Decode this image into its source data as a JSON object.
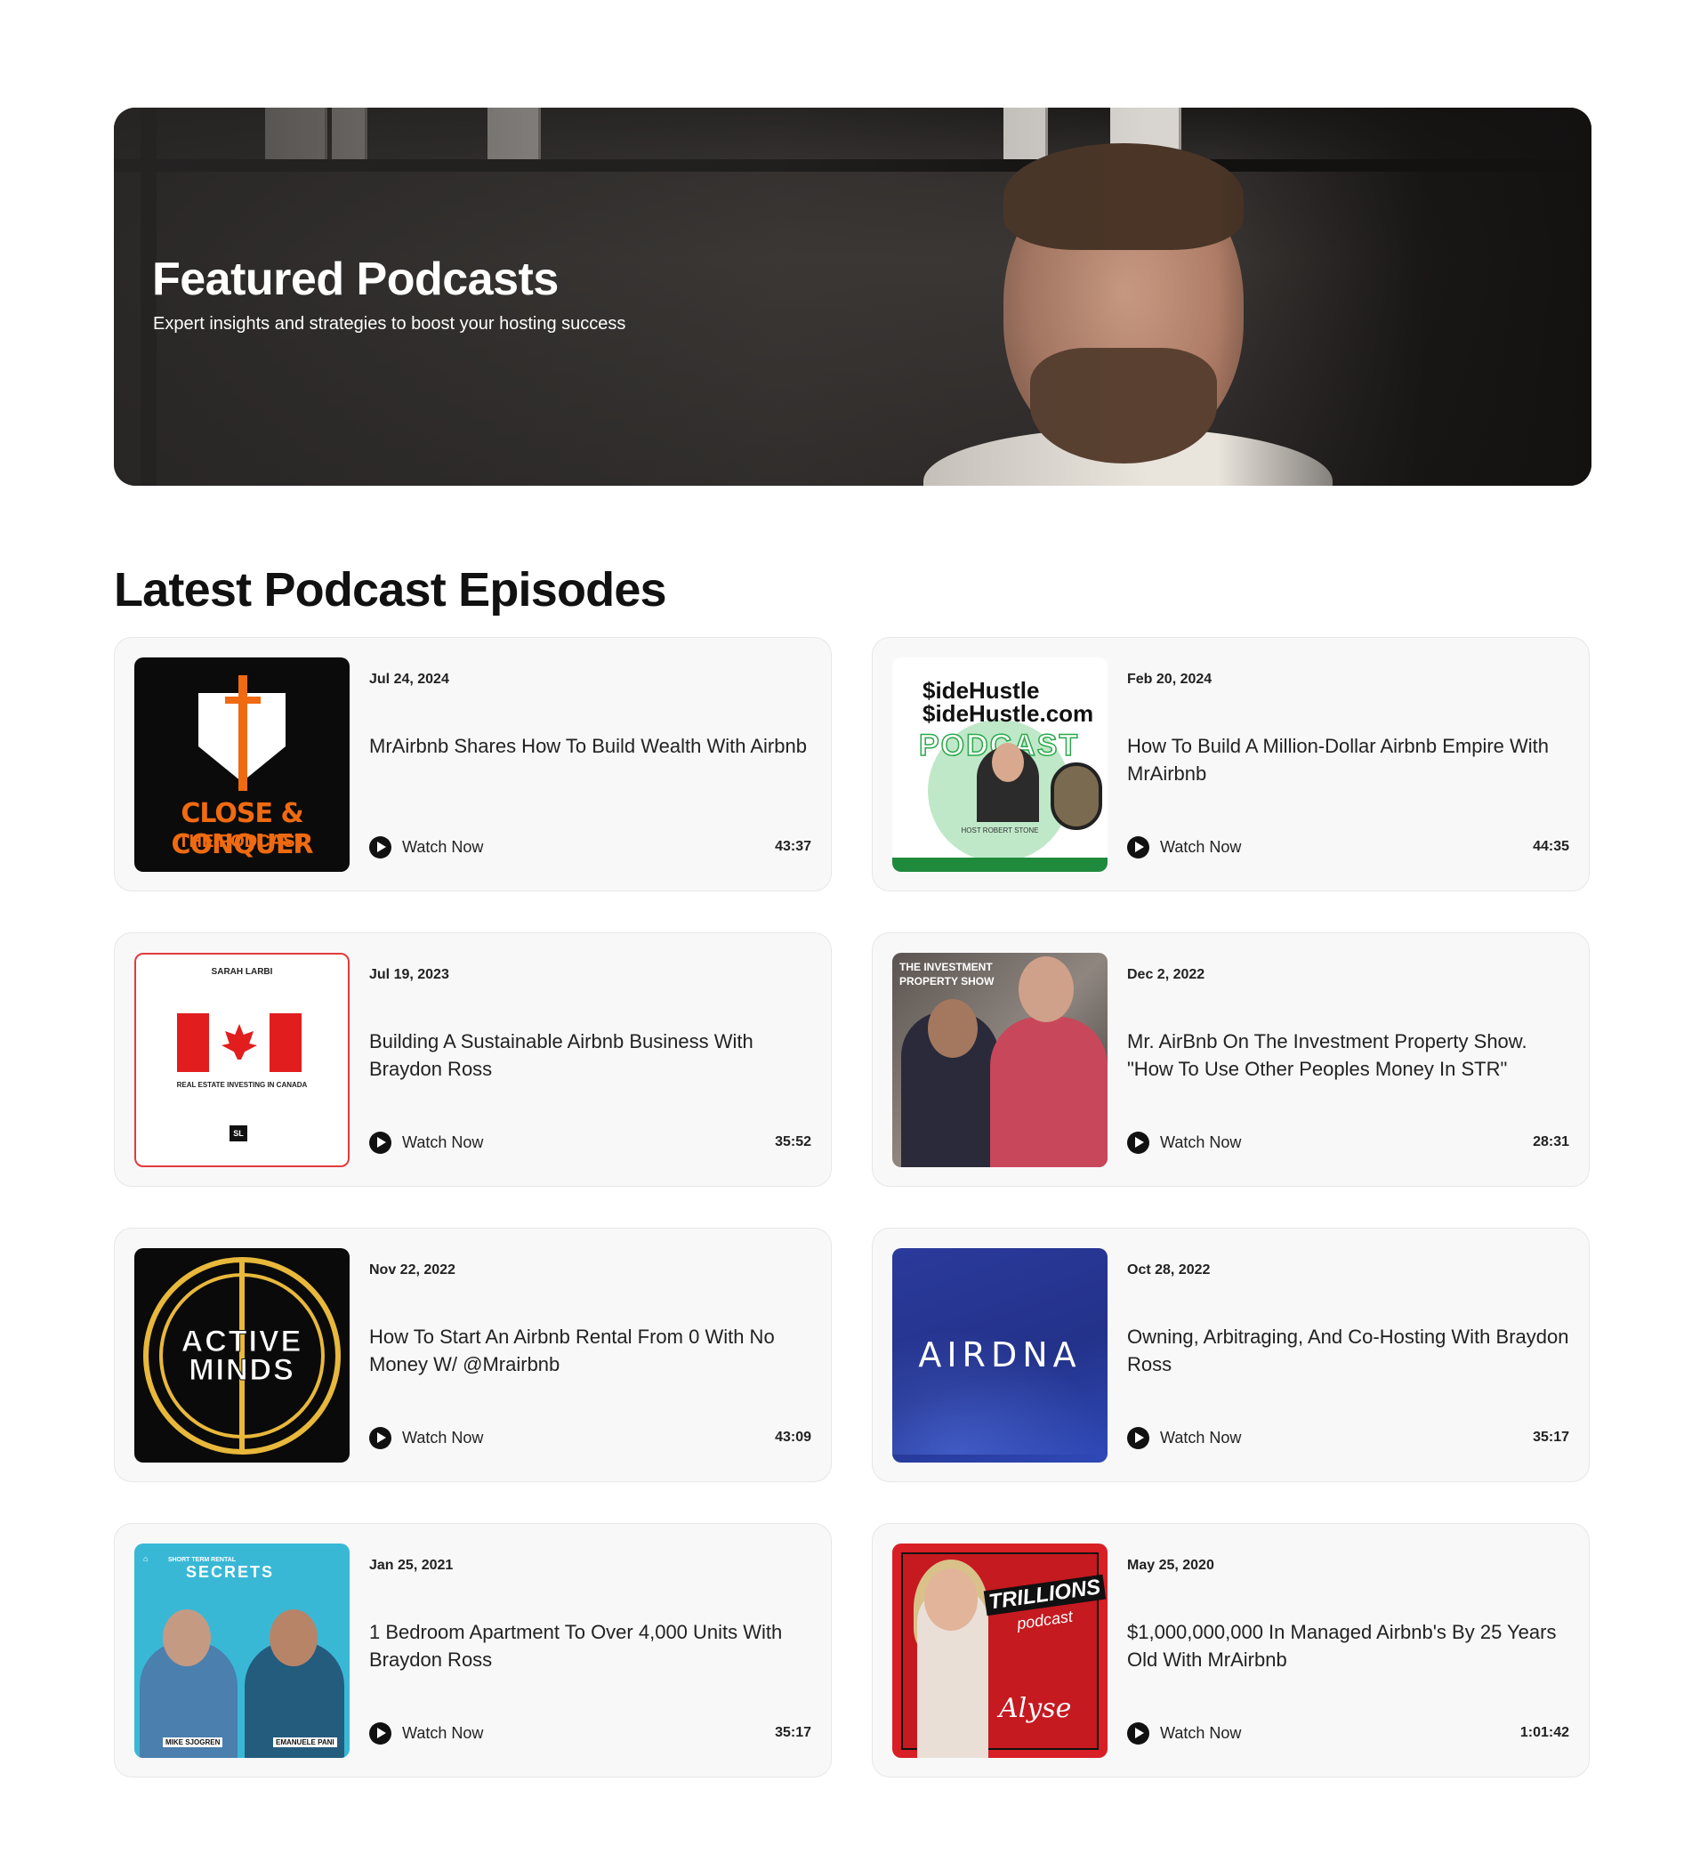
{
  "hero": {
    "title": "Featured Podcasts",
    "subtitle": "Expert insights and strategies to boost your hosting success"
  },
  "section": {
    "title": "Latest Podcast Episodes"
  },
  "watch_label": "Watch Now",
  "episodes": [
    {
      "date": "Jul 24, 2024",
      "title": "MrAirbnb Shares How To Build Wealth With Airbnb",
      "duration": "43:37",
      "thumb": {
        "line1": "CLOSE & CONQUER",
        "line2": "THE PODCAST"
      }
    },
    {
      "date": "Feb 20, 2024",
      "title": "How To Build A Million-Dollar Airbnb Empire With MrAirbnb",
      "duration": "44:35",
      "thumb": {
        "line1": "$ideHustle",
        "line2": "$ideHustle.com",
        "line3": "PODCAST",
        "host": "HOST ROBERT STONE"
      }
    },
    {
      "date": "Jul 19, 2023",
      "title": "Building A Sustainable Airbnb Business With Braydon Ross",
      "duration": "35:52",
      "thumb": {
        "name": "SARAH LARBI",
        "caption": "REAL ESTATE INVESTING IN CANADA",
        "badge": "SL"
      }
    },
    {
      "date": "Dec 2, 2022",
      "title": "Mr. AirBnb On The Investment Property Show. \"How To Use Other Peoples Money In STR\"",
      "duration": "28:31",
      "thumb": {
        "line1": "THE INVESTMENT",
        "line2": "PROPERTY SHOW"
      }
    },
    {
      "date": "Nov 22, 2022",
      "title": "How To Start An Airbnb Rental From 0 With No Money W/ @Mrairbnb",
      "duration": "43:09",
      "thumb": {
        "line1": "ACTIVE",
        "line2": "MINDS"
      }
    },
    {
      "date": "Oct 28, 2022",
      "title": "Owning, Arbitraging, And Co-Hosting With Braydon Ross",
      "duration": "35:17",
      "thumb": {
        "logo": "AIRDNA"
      }
    },
    {
      "date": "Jan 25, 2021",
      "title": "1 Bedroom Apartment To Over 4,000 Units With Braydon Ross",
      "duration": "35:17",
      "thumb": {
        "small": "SHORT TERM RENTAL",
        "logo": "SECRETS",
        "name1": "MIKE SJOGREN",
        "name2": "EMANUELE PANI"
      }
    },
    {
      "date": "May 25, 2020",
      "title": "$1,000,000,000 In Managed Airbnb's By 25 Years Old With MrAirbnb",
      "duration": "1:01:42",
      "thumb": {
        "line1": "TRILLIONS",
        "line2": "podcast",
        "sig": "Alyse"
      }
    }
  ]
}
